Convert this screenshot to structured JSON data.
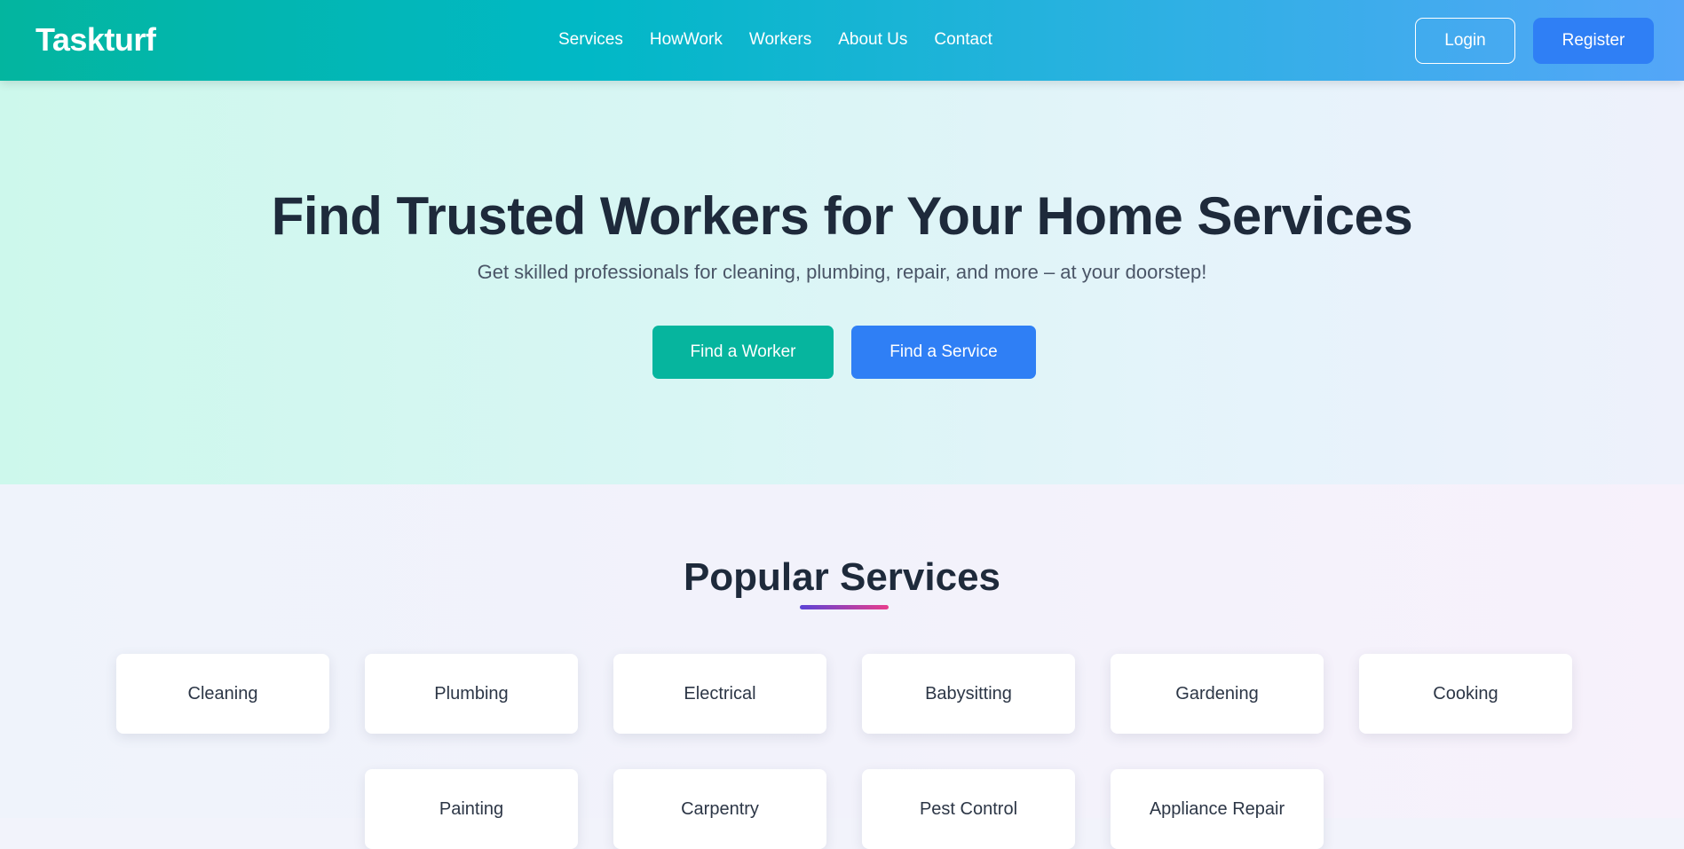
{
  "navbar": {
    "brand": "Taskturf",
    "links": [
      "Services",
      "HowWork",
      "Workers",
      "About Us",
      "Contact"
    ],
    "login_label": "Login",
    "register_label": "Register"
  },
  "hero": {
    "title": "Find Trusted Workers for Your Home Services",
    "subtitle": "Get skilled professionals for cleaning, plumbing, repair, and more – at your doorstep!",
    "find_worker_label": "Find a Worker",
    "find_service_label": "Find a Service"
  },
  "popular_services": {
    "title": "Popular Services",
    "items": [
      "Cleaning",
      "Plumbing",
      "Electrical",
      "Babysitting",
      "Gardening",
      "Cooking",
      "Painting",
      "Carpentry",
      "Pest Control",
      "Appliance Repair"
    ]
  },
  "colors": {
    "teal_accent": "#06b59e",
    "blue_accent": "#2f7ff5",
    "heading_text": "#1e2a3b"
  }
}
